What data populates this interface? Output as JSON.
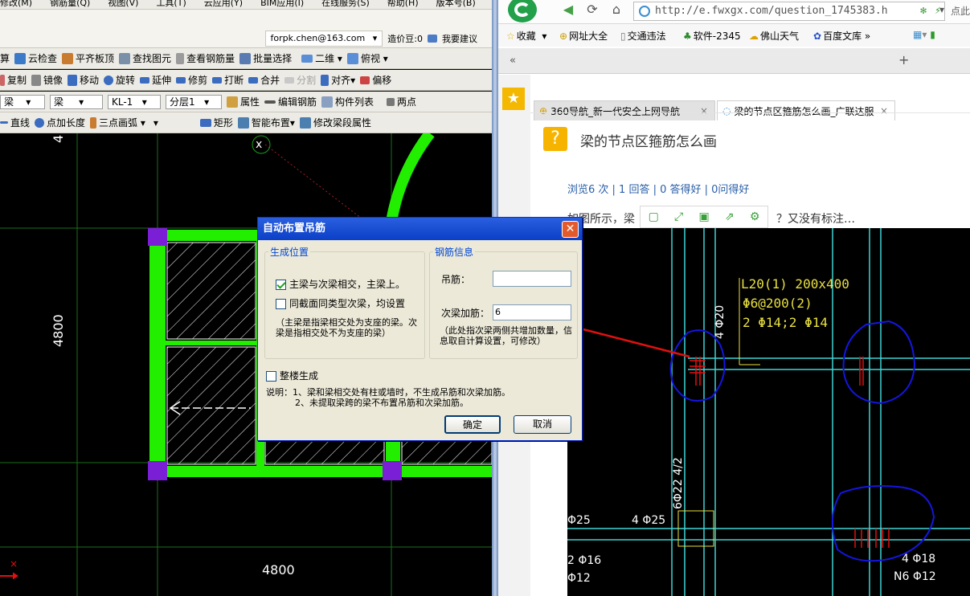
{
  "cad": {
    "menu": [
      "修改(M)",
      "钢筋量(Q)",
      "视图(V)",
      "工具(T)",
      "云应用(Y)",
      "BIM应用(I)",
      "在线服务(S)",
      "帮助(H)",
      "版本号(B)"
    ],
    "account": "forpk.chen@163.com",
    "cost_beans": "造价豆:0",
    "suggest": "我要建议",
    "toolbar1": [
      "算",
      "云检查",
      "平齐板顶",
      "查找图元",
      "查看钢筋量",
      "批量选择",
      "二维",
      "俯视"
    ],
    "toolbar2": [
      "复制",
      "镜像",
      "移动",
      "旋转",
      "延伸",
      "修剪",
      "打断",
      "合并",
      "分割",
      "对齐",
      "偏移"
    ],
    "toolbar3": {
      "cat1": "梁",
      "cat2": "梁",
      "cat3": "KL-1",
      "floor": "分层1",
      "items": [
        "属性",
        "编辑钢筋",
        "构件列表",
        "两点"
      ]
    },
    "toolbar4": [
      "直线",
      "点加长度",
      "三点画弧",
      "矩形",
      "智能布置",
      "修改梁段属性"
    ],
    "dims": {
      "left": "4800",
      "bottom": "4800",
      "top": "4"
    },
    "axis_x": "x"
  },
  "dialog": {
    "title": "自动布置吊筋",
    "close": "✕",
    "group1": {
      "legend": "生成位置",
      "opt1": "主梁与次梁相交，主梁上。",
      "opt1_checked": true,
      "opt2": "同截面同类型次梁，均设置",
      "opt2_checked": false,
      "note": "（主梁是指梁相交处为支座的梁。次梁是指相交处不为支座的梁）"
    },
    "group2": {
      "legend": "钢筋信息",
      "hanger_label": "吊筋：",
      "hanger_value": "",
      "extra_label": "次梁加筋：",
      "extra_value": "6",
      "note": "（此处指次梁两侧共增加数量，信息取自计算设置，可修改）"
    },
    "whole_floor": "整楼生成",
    "whole_floor_checked": false,
    "desc1": "说明：1、梁和梁相交处有柱或墙时，不生成吊筋和次梁加筋。",
    "desc2": "2、未提取梁跨的梁不布置吊筋和次梁加筋。",
    "ok": "确定",
    "cancel": "取消"
  },
  "browser": {
    "url": "http://e.fwxgx.com/question_1745383.h",
    "address_tail": "点此",
    "bookmarks": [
      "收藏",
      "网址大全",
      "交通违法",
      "软件-2345",
      "佛山天气",
      "百度文库"
    ],
    "tabs": [
      {
        "label": "360导航_新一代安全上网导航",
        "active": false
      },
      {
        "label": "梁的节点区箍筋怎么画_广联达服",
        "active": true
      }
    ],
    "new_tab": "+",
    "question": {
      "icon": "?",
      "title": "梁的节点区箍筋怎么画",
      "stats": "浏览6 次 | 1 回答 | 0 答得好 | 0问得好",
      "body_start": "如图所示，梁",
      "body_end": "？又没有标注…"
    },
    "drawing": {
      "beam_label": "L20(1) 200x400",
      "stirrup": "Φ6@200(2)",
      "bars": "2 Φ14;2 Φ14",
      "vert1": "4 Φ20",
      "vert2": "6Φ22 4/2",
      "lbl_25a": "Φ25",
      "lbl_25b": "4 Φ25",
      "lbl_16": "2 Φ16",
      "lbl_12": "Φ12",
      "lbl_18": "4 Φ18",
      "lbl_n6": "N6 Φ12"
    }
  },
  "colors": {
    "beam_green": "#22ee00",
    "column_purple": "#7a1fd6",
    "arrow_red": "#e01010",
    "circle_blue": "#1515e0",
    "drawing_cyan": "#3fd4d4",
    "drawing_yellow": "#e8e040"
  }
}
